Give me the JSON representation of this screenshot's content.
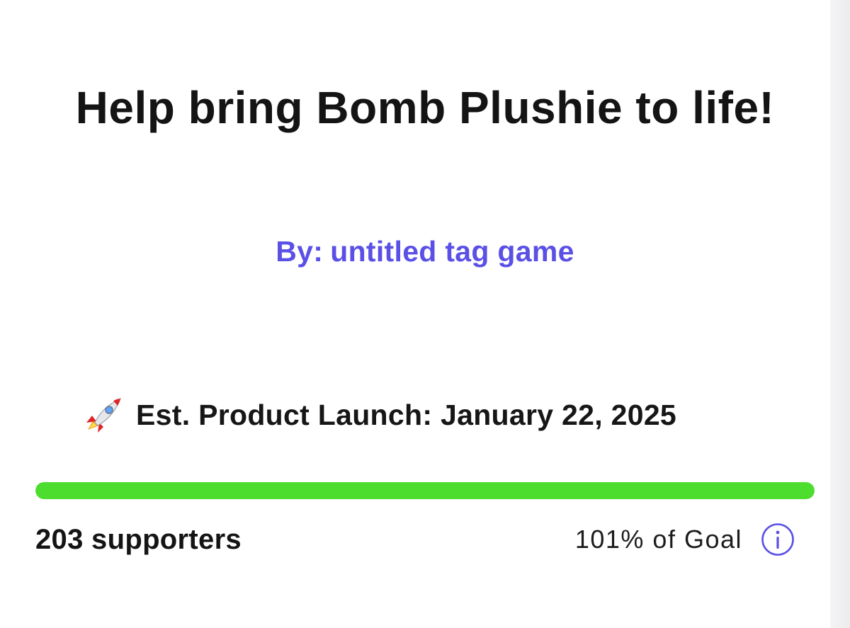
{
  "campaign": {
    "title": "Help bring Bomb Plushie to life!",
    "byline_prefix": "By:",
    "creator": "untitled tag game",
    "launch_icon": "rocket-icon",
    "launch_text": "Est. Product Launch: January 22, 2025",
    "progress_fraction": 1.0,
    "supporters_text": "203 supporters",
    "goal_text": "101% of Goal",
    "info_icon": "info-icon"
  },
  "colors": {
    "accent": "#5b50e6",
    "progress": "#4ddd2e",
    "text": "#141414",
    "background": "#ffffff"
  }
}
